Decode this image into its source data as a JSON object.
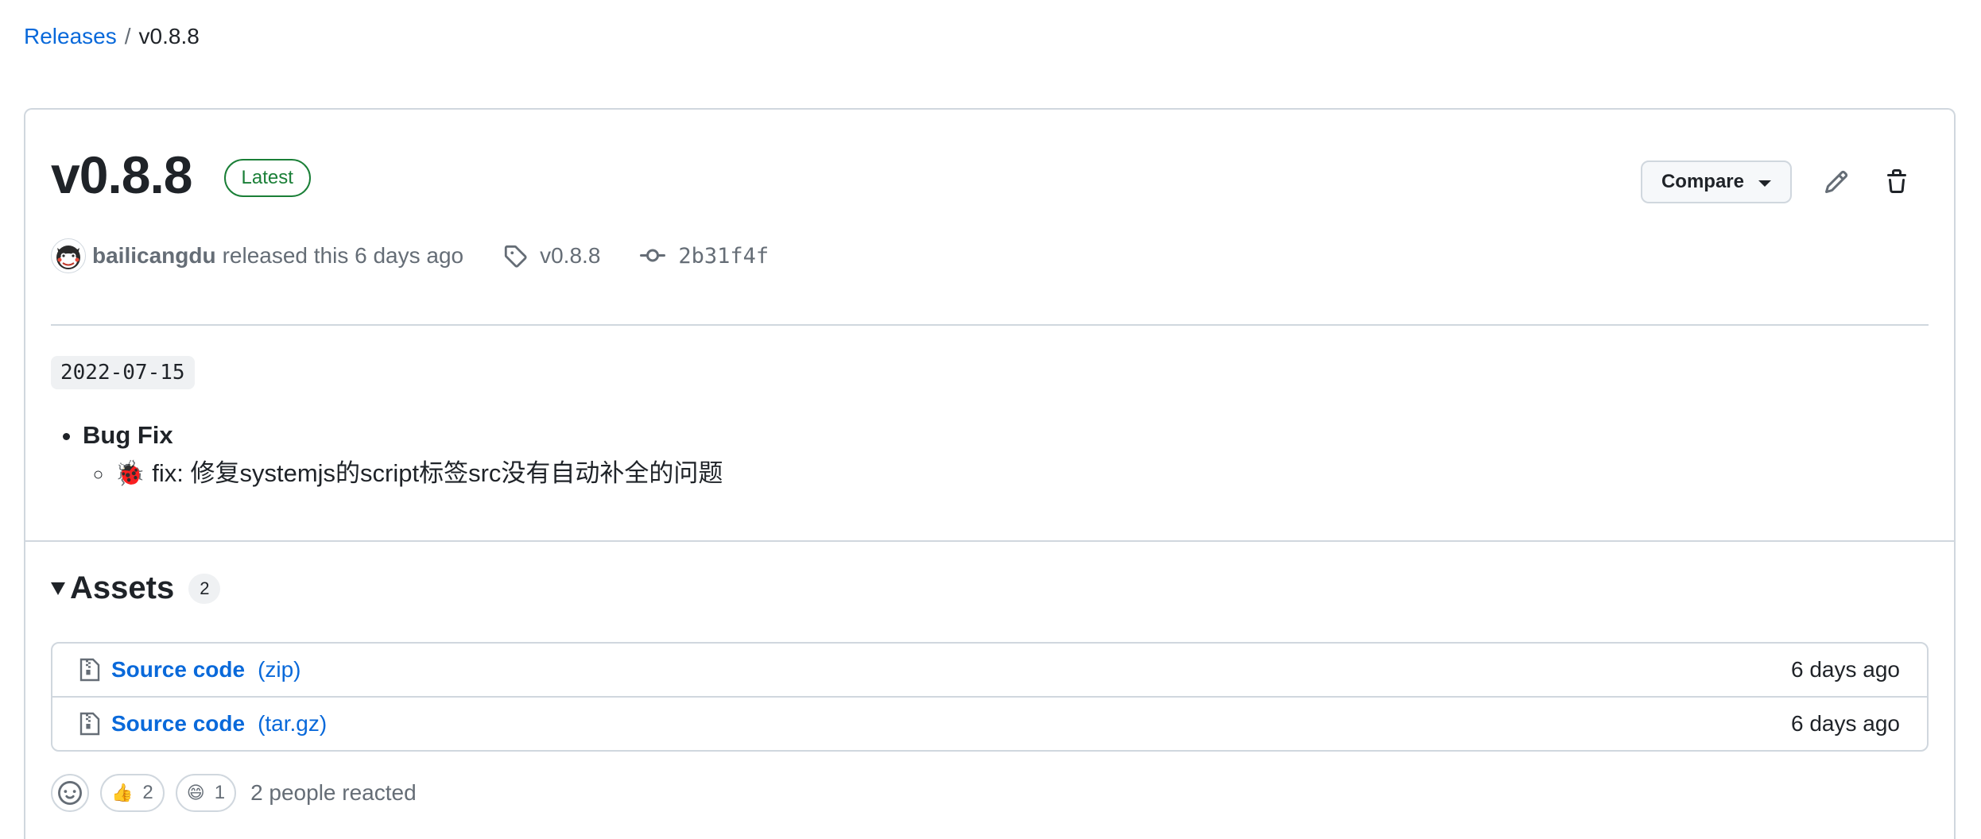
{
  "breadcrumb": {
    "releases_label": "Releases",
    "separator": "/",
    "current": "v0.8.8"
  },
  "release": {
    "title": "v0.8.8",
    "latest_badge": "Latest",
    "compare_label": "Compare",
    "author": "bailicangdu",
    "released_text": "released this 6 days ago",
    "tag": "v0.8.8",
    "commit": "2b31f4f",
    "date": "2022-07-15",
    "notes": {
      "heading": "Bug Fix",
      "items": [
        {
          "emoji": "🐞",
          "text": "fix: 修复systemjs的script标签src没有自动补全的问题"
        }
      ]
    }
  },
  "assets": {
    "title": "Assets",
    "count": "2",
    "items": [
      {
        "name": "Source code",
        "ext": "(zip)",
        "date": "6 days ago"
      },
      {
        "name": "Source code",
        "ext": "(tar.gz)",
        "date": "6 days ago"
      }
    ]
  },
  "reactions": {
    "items": [
      {
        "emoji": "👍",
        "count": "2"
      },
      {
        "emoji": "😄",
        "count": "1"
      }
    ],
    "summary": "2 people reacted"
  },
  "colors": {
    "link": "#0969da",
    "success": "#1a7f37",
    "border": "#d0d7de",
    "muted": "#656d76"
  }
}
